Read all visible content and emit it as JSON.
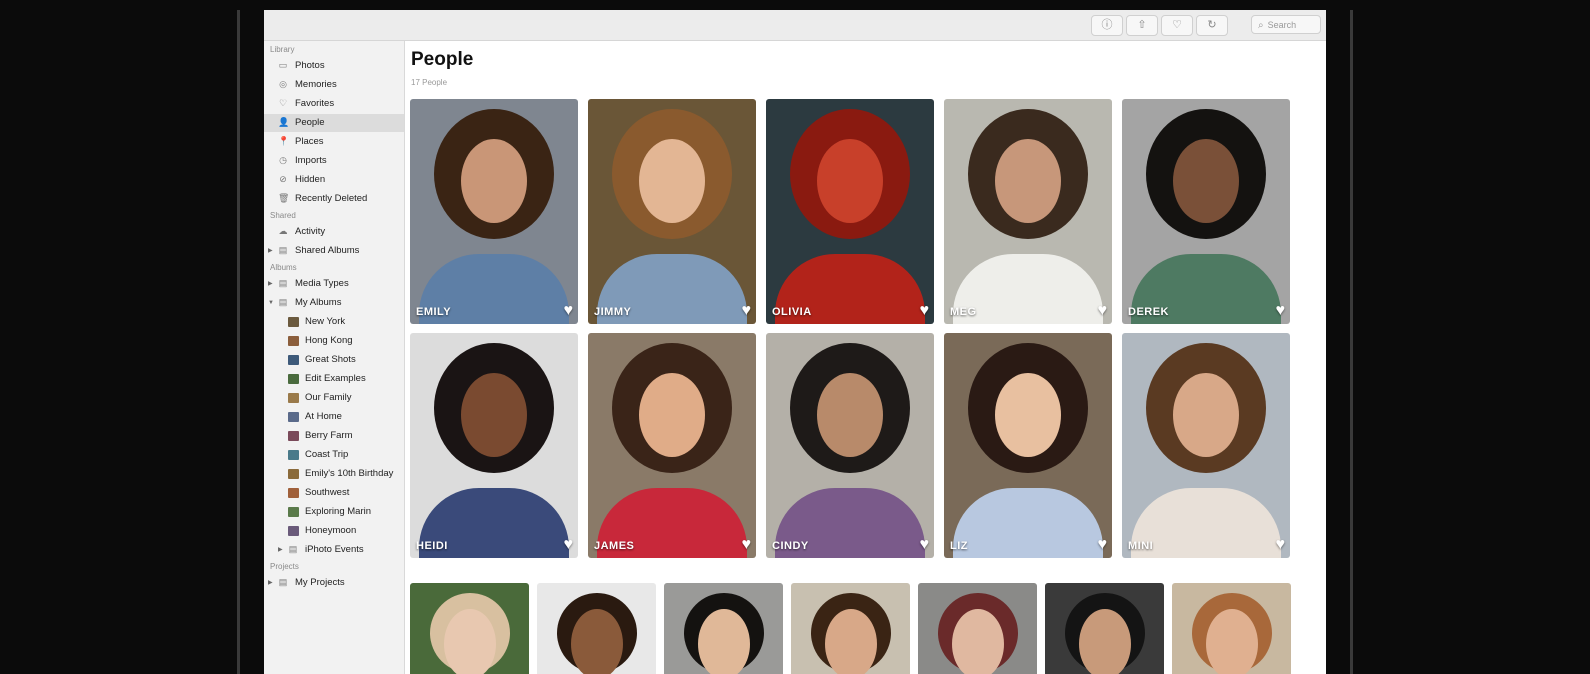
{
  "toolbar": {
    "buttons": [
      {
        "name": "info-button",
        "glyph": "ⓘ"
      },
      {
        "name": "share-button",
        "glyph": "⇧"
      },
      {
        "name": "favorite-button",
        "glyph": "♡"
      },
      {
        "name": "rotate-button",
        "glyph": "↻"
      }
    ],
    "search_placeholder": "Search"
  },
  "sidebar": {
    "sections": [
      {
        "title": "Library",
        "items": [
          {
            "label": "Photos",
            "icon": "photos-icon",
            "glyph": "▭"
          },
          {
            "label": "Memories",
            "icon": "memories-icon",
            "glyph": "◎"
          },
          {
            "label": "Favorites",
            "icon": "heart-icon",
            "glyph": "♡"
          },
          {
            "label": "People",
            "icon": "person-icon",
            "glyph": "👤",
            "selected": true
          },
          {
            "label": "Places",
            "icon": "pin-icon",
            "glyph": "📍"
          },
          {
            "label": "Imports",
            "icon": "clock-icon",
            "glyph": "◷"
          },
          {
            "label": "Hidden",
            "icon": "hidden-icon",
            "glyph": "⊘"
          },
          {
            "label": "Recently Deleted",
            "icon": "trash-icon",
            "glyph": "🗑"
          }
        ]
      },
      {
        "title": "Shared",
        "items": [
          {
            "label": "Activity",
            "icon": "cloud-icon",
            "glyph": "☁"
          },
          {
            "label": "Shared Albums",
            "icon": "folder-icon",
            "glyph": "▤",
            "disclosure": true
          }
        ]
      },
      {
        "title": "Albums",
        "items": [
          {
            "label": "Media Types",
            "icon": "folder-icon",
            "glyph": "▤",
            "disclosure": true
          },
          {
            "label": "My Albums",
            "icon": "folder-icon",
            "glyph": "▤",
            "disclosure": true,
            "expanded": true
          }
        ]
      }
    ],
    "albums": [
      {
        "label": "New York",
        "color": "#6b5a3e"
      },
      {
        "label": "Hong Kong",
        "color": "#8b5e3c"
      },
      {
        "label": "Great Shots",
        "color": "#3e5a7a"
      },
      {
        "label": "Edit Examples",
        "color": "#4a6b3e"
      },
      {
        "label": "Our Family",
        "color": "#9a7a4a"
      },
      {
        "label": "At Home",
        "color": "#5a6a8a"
      },
      {
        "label": "Berry Farm",
        "color": "#7a4a5a"
      },
      {
        "label": "Coast Trip",
        "color": "#4a7a8a"
      },
      {
        "label": "Emily's 10th Birthday",
        "color": "#8a6a3a"
      },
      {
        "label": "Southwest",
        "color": "#a0603a"
      },
      {
        "label": "Exploring Marin",
        "color": "#5a7a4a"
      },
      {
        "label": "Honeymoon",
        "color": "#6a5a7a"
      }
    ],
    "iphoto_events": "iPhoto Events",
    "projects_title": "Projects",
    "my_projects": "My Projects"
  },
  "main": {
    "title": "People",
    "subtitle": "17 People",
    "people": [
      {
        "name": "EMILY",
        "bg": "#7f8690",
        "hair": "#3a2414",
        "skin": "#c99677",
        "shirt": "#5e7fa6"
      },
      {
        "name": "JIMMY",
        "bg": "#6a5637",
        "hair": "#8a5a2e",
        "skin": "#e3b694",
        "shirt": "#7f9ab8"
      },
      {
        "name": "OLIVIA",
        "bg": "#2c3a40",
        "hair": "#8a1a10",
        "skin": "#c8402a",
        "shirt": "#b2231a"
      },
      {
        "name": "MEG",
        "bg": "#b9b8b0",
        "hair": "#3a2a1e",
        "skin": "#c7977a",
        "shirt": "#eeeeea"
      },
      {
        "name": "DEREK",
        "bg": "#a4a4a4",
        "hair": "#141210",
        "skin": "#7a5038",
        "shirt": "#4e7a62"
      },
      {
        "name": "HEIDI",
        "bg": "#dcdcdc",
        "hair": "#1a1414",
        "skin": "#7a4a30",
        "shirt": "#3a4a7a"
      },
      {
        "name": "JAMES",
        "bg": "#8a7a68",
        "hair": "#3a2418",
        "skin": "#e0ac88",
        "shirt": "#c8283a"
      },
      {
        "name": "CINDY",
        "bg": "#b4b0a8",
        "hair": "#1e1a18",
        "skin": "#b88a6a",
        "shirt": "#7a5a8a"
      },
      {
        "name": "LIZ",
        "bg": "#7a6a58",
        "hair": "#2a1a14",
        "skin": "#e8c0a0",
        "shirt": "#b8c8e0"
      },
      {
        "name": "MINI",
        "bg": "#b0b8c0",
        "hair": "#5a3a22",
        "skin": "#d8a888",
        "shirt": "#e8e0d8"
      }
    ],
    "row3": [
      {
        "name": "person-11",
        "bg": "#4a6a3a",
        "skin": "#e8c8b0",
        "hair": "#d8c0a0"
      },
      {
        "name": "person-12",
        "bg": "#e8e8e8",
        "skin": "#8a5a3a",
        "hair": "#2a1a10"
      },
      {
        "name": "person-13",
        "bg": "#9a9a98",
        "skin": "#e0b898",
        "hair": "#141210"
      },
      {
        "name": "person-14",
        "bg": "#c8c0b0",
        "skin": "#d8a888",
        "hair": "#3a2414"
      },
      {
        "name": "person-15",
        "bg": "#8a8a88",
        "skin": "#e0b8a0",
        "hair": "#6a2a2a"
      },
      {
        "name": "person-16",
        "bg": "#3a3a3a",
        "skin": "#c89a7a",
        "hair": "#141414"
      },
      {
        "name": "person-17",
        "bg": "#c8b8a0",
        "skin": "#e0b090",
        "hair": "#a8683a"
      }
    ]
  }
}
